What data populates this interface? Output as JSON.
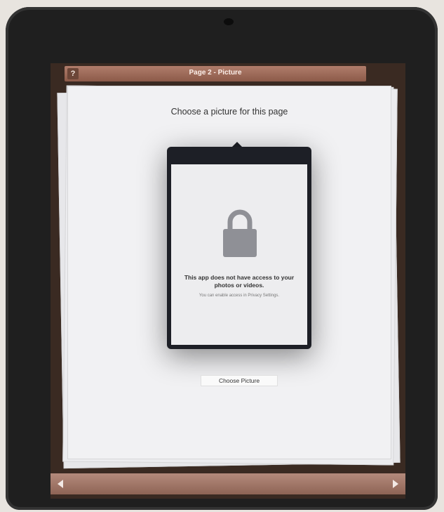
{
  "header": {
    "help_label": "?",
    "title": "Page 2 - Picture"
  },
  "page": {
    "prompt": "Choose a picture for this page"
  },
  "popover": {
    "icon": "lock-icon",
    "heading": "This app does not have access to your photos or videos.",
    "subtext": "You can enable access in Privacy Settings."
  },
  "actions": {
    "choose_picture_label": "Choose Picture"
  },
  "footer": {
    "prev_icon": "arrow-left-icon",
    "next_icon": "arrow-right-icon"
  },
  "colors": {
    "toolbar": "#9c6a58",
    "popover_frame": "#1d1f26",
    "lock": "#8f9096"
  }
}
